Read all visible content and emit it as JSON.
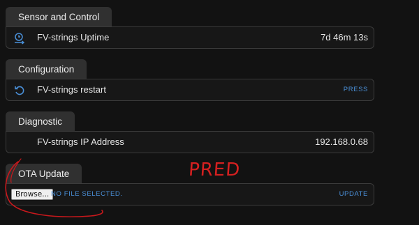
{
  "sections": {
    "sensor": {
      "title": "Sensor and Control",
      "row": {
        "icon": "timer-clock-icon",
        "label": "FV-strings Uptime",
        "value": "7d 46m 13s"
      }
    },
    "config": {
      "title": "Configuration",
      "row": {
        "icon": "restart-icon",
        "label": "FV-strings restart",
        "action": "PRESS"
      }
    },
    "diagnostic": {
      "title": "Diagnostic",
      "row": {
        "label": "FV-strings IP Address",
        "value": "192.168.0.68"
      }
    },
    "ota": {
      "title": "OTA Update",
      "browse_label": "Browse...",
      "file_status": "NO FILE SELECTED.",
      "action": "UPDATE"
    }
  },
  "annotation": {
    "text": "PRED",
    "color": "#d42020"
  },
  "colors": {
    "accent": "#4a90d9",
    "background": "#121212",
    "tab": "#303030"
  }
}
